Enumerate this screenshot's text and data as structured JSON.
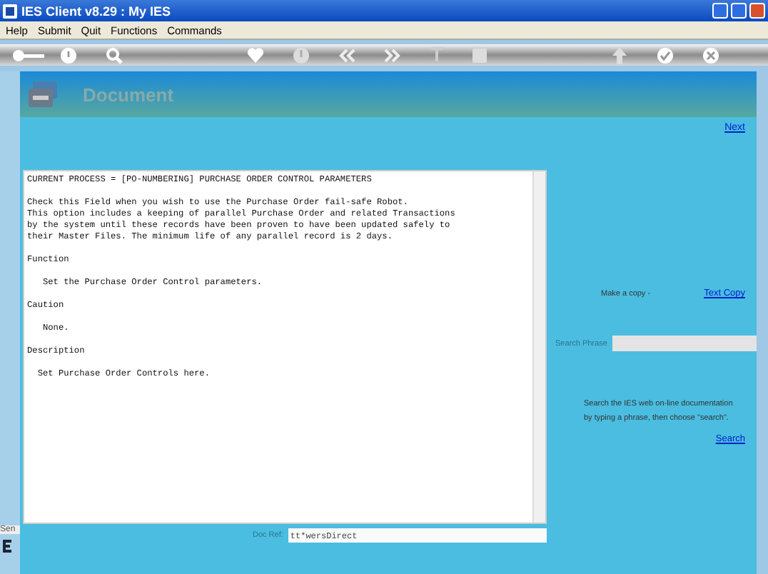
{
  "window": {
    "title": "IES Client v8.29 : My IES"
  },
  "menu": [
    "Help",
    "Submit",
    "Quit",
    "Functions",
    "Commands"
  ],
  "header": {
    "title": "Document"
  },
  "next_link": "Next",
  "document": {
    "paragraphs": [
      "CURRENT PROCESS = [PO-NUMBERING] PURCHASE ORDER CONTROL PARAMETERS",
      "Check this Field when you wish to use the Purchase Order fail-safe Robot.\nThis option includes a keeping of parallel Purchase Order and related Transactions\nby the system until these records have been proven to have been updated safely to\ntheir Master Files. The minimum life of any parallel record is 2 days.",
      "Function",
      "   Set the Purchase Order Control parameters.",
      "Caution",
      "   None.",
      "Description",
      "  Set Purchase Order Controls here."
    ]
  },
  "copy": {
    "label": "Make a copy -",
    "link": "Text Copy"
  },
  "search": {
    "label": "Search Phrase",
    "hint": "Search the IES web on-line documentation\nby typing a phrase, then choose \"search\".",
    "link": "Search"
  },
  "doc_ref": {
    "label": "Doc Ref:",
    "value": "tt*wersDirect"
  },
  "side_text": "Sen"
}
